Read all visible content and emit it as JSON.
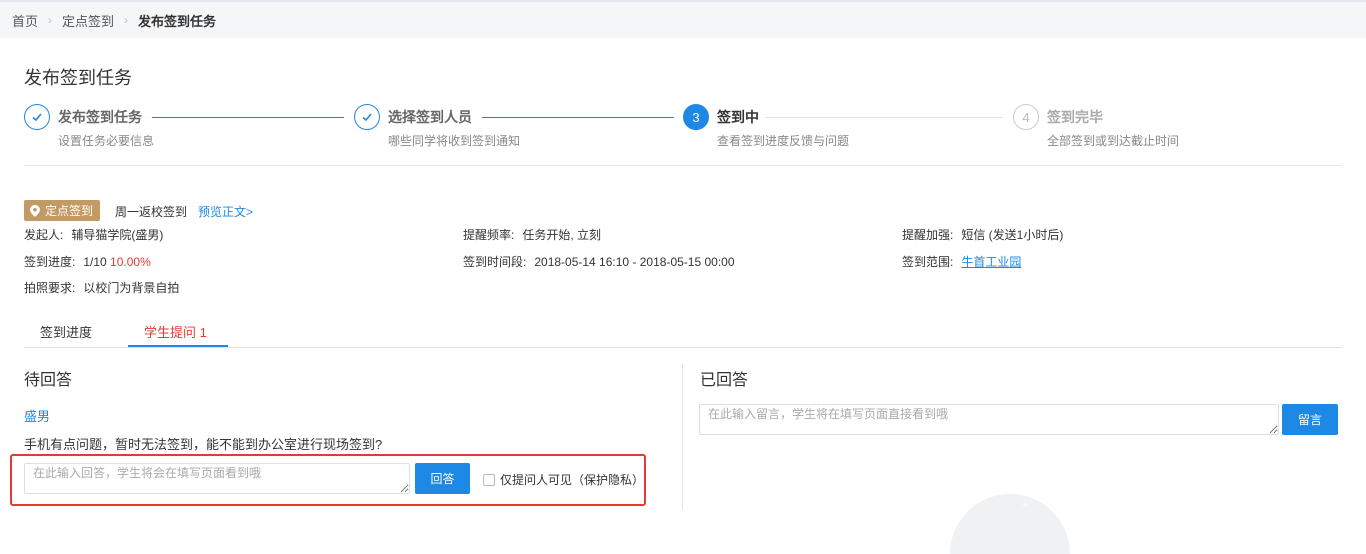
{
  "breadcrumb": {
    "home": "首页",
    "level1": "定点签到",
    "current": "发布签到任务"
  },
  "page": {
    "title": "发布签到任务"
  },
  "steps": [
    {
      "num": "1",
      "title": "发布签到任务",
      "desc": "设置任务必要信息",
      "status": "done"
    },
    {
      "num": "2",
      "title": "选择签到人员",
      "desc": "哪些同学将收到签到通知",
      "status": "done"
    },
    {
      "num": "3",
      "title": "签到中",
      "desc": "查看签到进度反馈与问题",
      "status": "active"
    },
    {
      "num": "4",
      "title": "签到完毕",
      "desc": "全部签到或到达截止时间",
      "status": "todo"
    }
  ],
  "task": {
    "tag": "定点签到",
    "name": "周一返校签到",
    "preview_link": "预览正文>",
    "initiator_label": "发起人:",
    "initiator": "辅导猫学院(盛男)",
    "reminder_freq_label": "提醒频率:",
    "reminder_freq": "任务开始, 立刻",
    "reminder_boost_label": "提醒加强:",
    "reminder_boost": "短信 (发送1小时后)",
    "progress_label": "签到进度:",
    "progress_count": "1/10",
    "progress_percent": "10.00%",
    "period_label": "签到时间段:",
    "period": "2018-05-14 16:10 - 2018-05-15 00:00",
    "range_label": "签到范围:",
    "range": "牛首工业园",
    "photo_label": "拍照要求:",
    "photo": "以校门为背景自拍"
  },
  "tabs": [
    {
      "label": "签到进度",
      "active": false
    },
    {
      "label": "学生提问 1",
      "active": true
    }
  ],
  "pending": {
    "title": "待回答",
    "asker": "盛男",
    "question": "手机有点问题，暂时无法签到，能不能到办公室进行现场签到?",
    "answer_placeholder": "在此输入回答，学生将会在填写页面看到哦",
    "answer_button": "回答",
    "private_label": "仅提问人可见（保护隐私）"
  },
  "answered": {
    "title": "已回答",
    "message_placeholder": "在此输入留言，学生将在填写页面直接看到哦",
    "message_button": "留言"
  },
  "colors": {
    "primary": "#1e88e5",
    "tag": "#c39a63",
    "alert": "#e53935"
  },
  "icons": {
    "step_done": "check-icon",
    "tag": "map-pin-icon",
    "separator": "chevron-right-icon"
  }
}
